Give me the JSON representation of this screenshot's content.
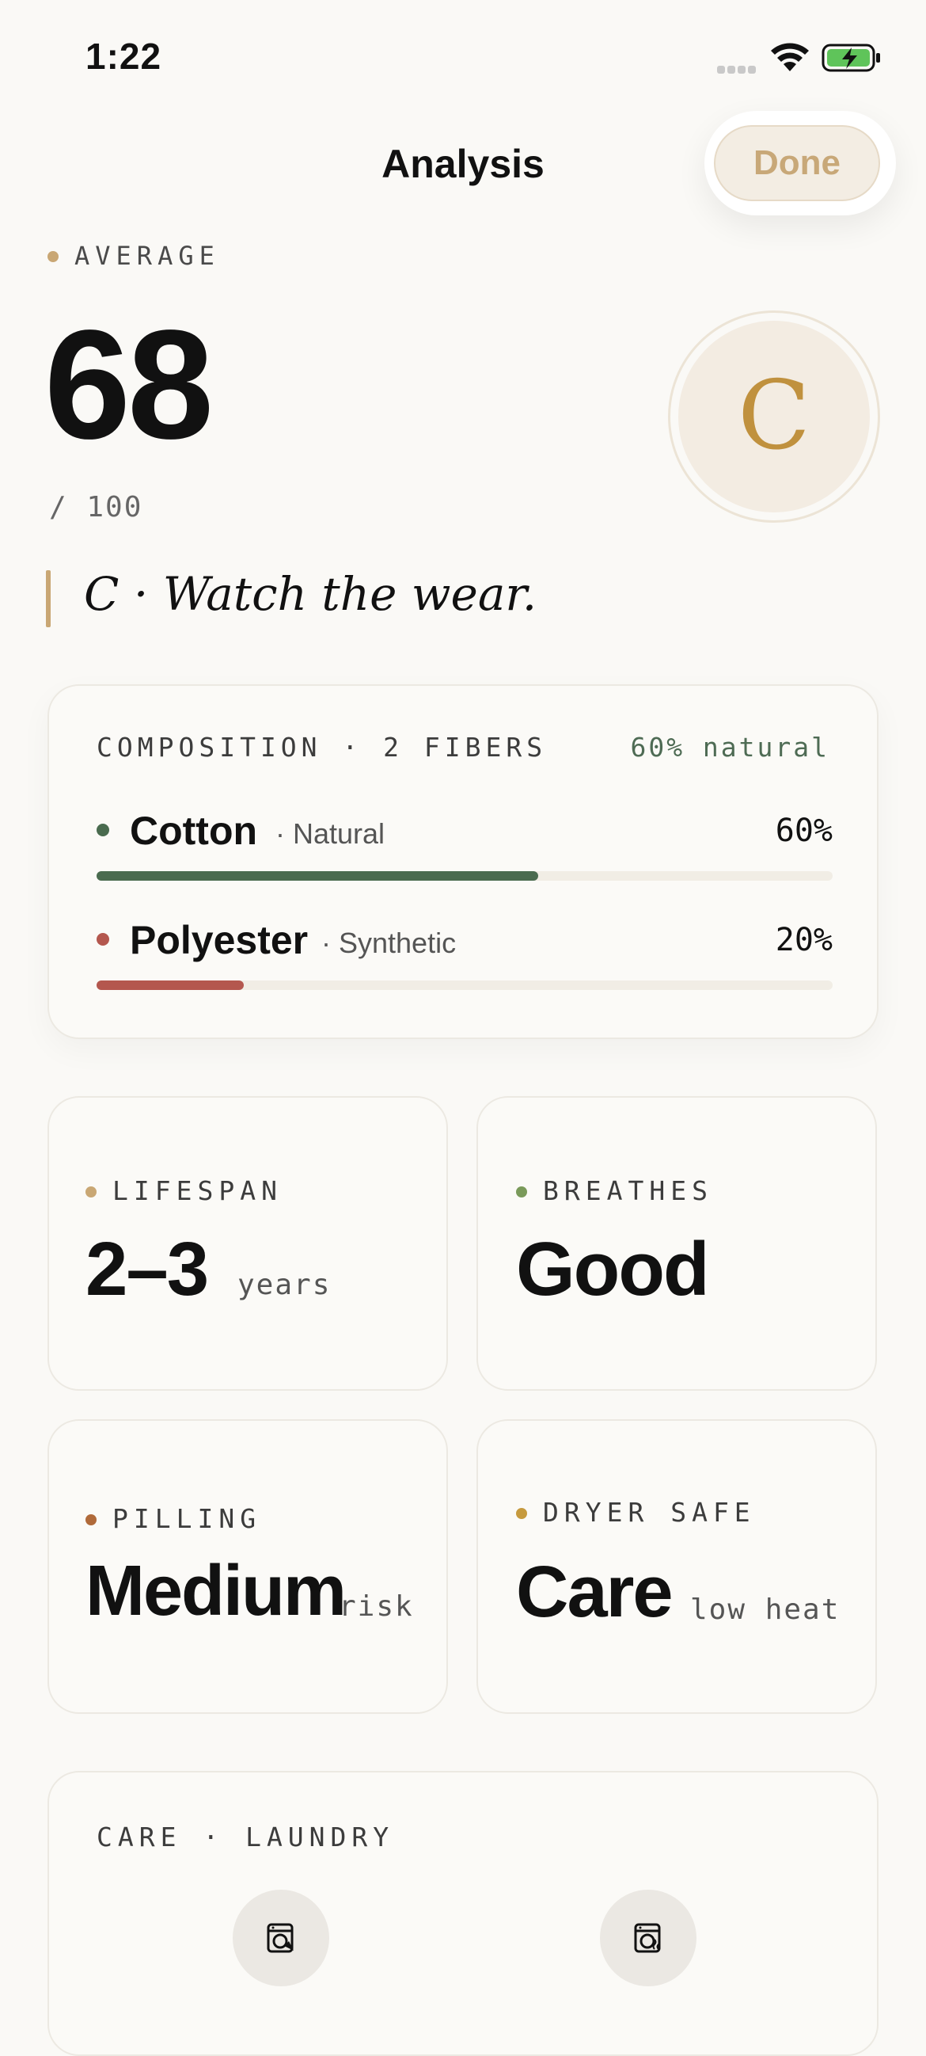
{
  "status_bar": {
    "time": "1:22"
  },
  "header": {
    "title": "Analysis",
    "done_label": "Done"
  },
  "score": {
    "label": "AVERAGE",
    "value": "68",
    "max": "/ 100",
    "grade": "C",
    "summary": "C · Watch the wear."
  },
  "composition": {
    "title": "COMPOSITION · 2 FIBERS",
    "natural_summary": "60% natural",
    "fibers": [
      {
        "name": "Cotton",
        "type": "· Natural",
        "percent": "60%",
        "fraction": 0.6,
        "color": "#4a6b4f"
      },
      {
        "name": "Polyester",
        "type": "· Synthetic",
        "percent": "20%",
        "fraction": 0.2,
        "color": "#b4574e"
      }
    ]
  },
  "stats": [
    {
      "label": "LIFESPAN",
      "value": "2–3",
      "unit": "years",
      "dot_color": "#c9a774"
    },
    {
      "label": "BREATHES",
      "value": "Good",
      "unit": "",
      "dot_color": "#7a9a5a"
    },
    {
      "label": "PILLING",
      "value": "Medium",
      "unit": "risk",
      "dot_color": "#b06a3a"
    },
    {
      "label": "DRYER SAFE",
      "value": "Care",
      "unit": "low heat",
      "dot_color": "#c69a3e"
    }
  ],
  "care": {
    "title": "CARE · LAUNDRY",
    "icons": [
      "washing-machine-icon",
      "dryer-icon"
    ]
  },
  "colors": {
    "accent": "#c8a878",
    "grade": "#c0913e",
    "background": "#faf9f6"
  }
}
